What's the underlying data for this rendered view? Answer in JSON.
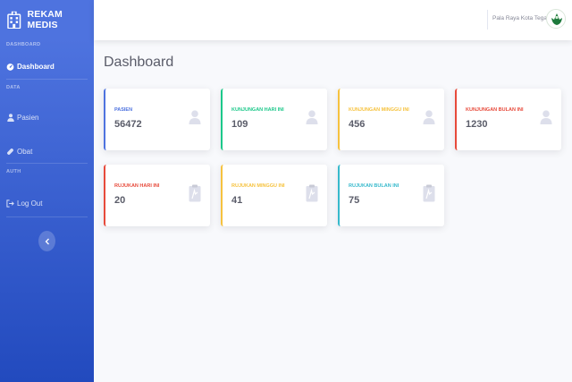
{
  "sidebar": {
    "brand": "REKAM MEDIS",
    "brand_icon": "hospital-icon",
    "headings": {
      "dashboard": "DASHBOARD",
      "data": "DATA",
      "auth": "AUTH"
    },
    "items": [
      {
        "label": "Dashboard",
        "icon": "tachometer-icon",
        "active": true
      },
      {
        "label": "Pasien",
        "icon": "user-icon"
      },
      {
        "label": "Obat",
        "icon": "capsule-icon"
      },
      {
        "label": "Log Out",
        "icon": "sign-out-icon"
      }
    ],
    "toggle_icon": "chevron-left-icon"
  },
  "topbar": {
    "user_name": "Pala Raya Kota Tegal",
    "avatar_icon": "logo-avatar-icon"
  },
  "page_title": "Dashboard",
  "cards": [
    {
      "label": "PASIEN",
      "value": "56472",
      "color": "#4e73df",
      "icon": "user-icon"
    },
    {
      "label": "KUNJUNGAN HARI INI",
      "value": "109",
      "color": "#1cc88a",
      "icon": "user-icon"
    },
    {
      "label": "KUNJUNGAN MINGGU INI",
      "value": "456",
      "color": "#f6c23e",
      "icon": "user-icon"
    },
    {
      "label": "KUNJUNGAN BULAN INI",
      "value": "1230",
      "color": "#e74a3b",
      "icon": "user-icon"
    },
    {
      "label": "RUJUKAN HARI INI",
      "value": "20",
      "color": "#e74a3b",
      "icon": "clipboard-icon"
    },
    {
      "label": "RUJUKAN MINGGU INI",
      "value": "41",
      "color": "#f6c23e",
      "icon": "clipboard-icon"
    },
    {
      "label": "RUJUKAN BULAN INI",
      "value": "75",
      "color": "#36b9cc",
      "icon": "clipboard-icon"
    }
  ]
}
